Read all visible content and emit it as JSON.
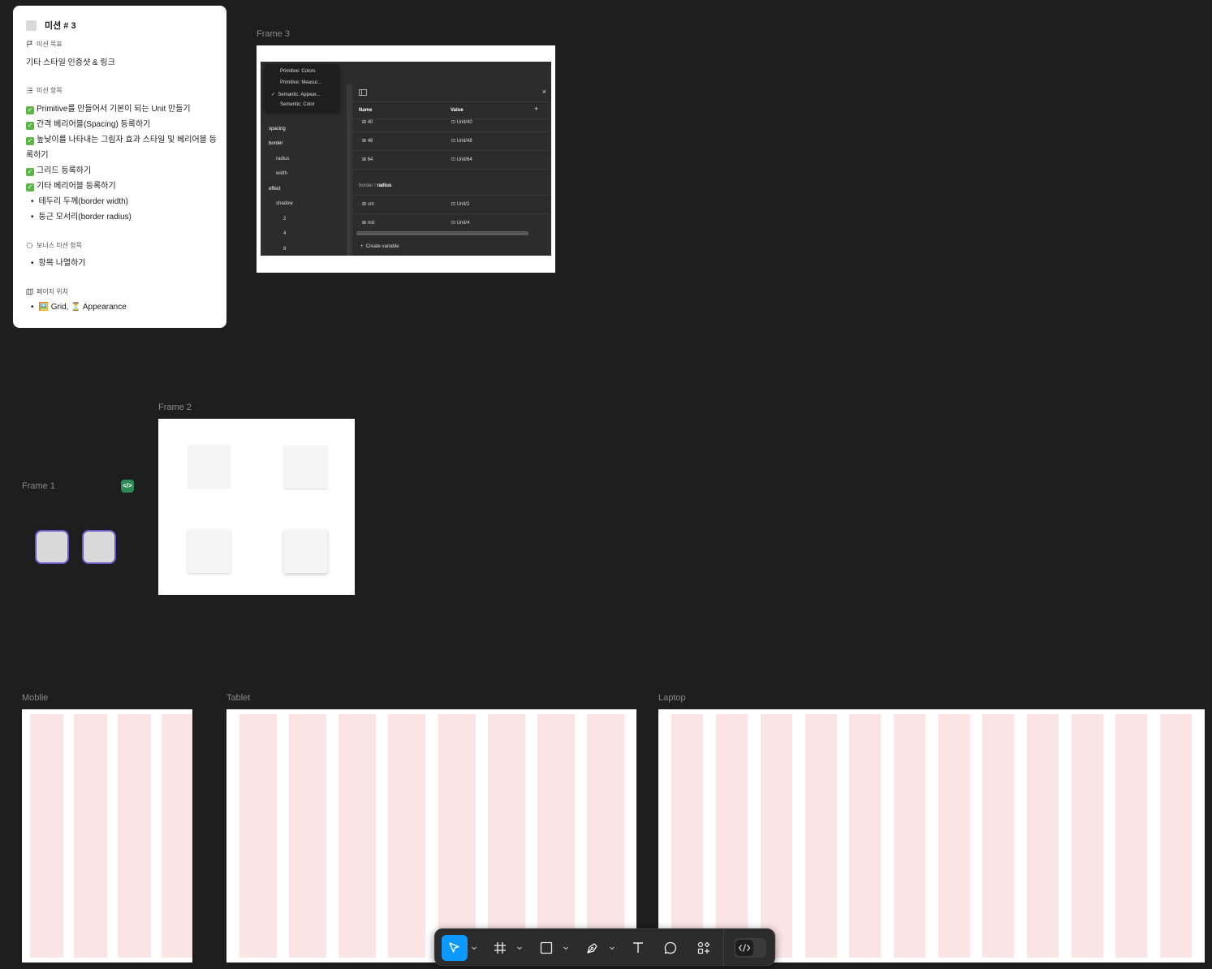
{
  "mission_card": {
    "title": "미션 # 3",
    "goal_heading": "미션 목표",
    "goal_text": "기타 스타일 인증샷 & 링크",
    "items_heading": "미션 항목",
    "items": [
      "Primitive를 만들어서 기본이 되는 Unit 만들기",
      "간격 베리어블(Spacing) 등록하기",
      "높낮이를 나타내는 그림자 효과 스타일 및 베리어블 등",
      "록하기",
      "그리드 등록하기",
      "기타 베리어블 등록하기"
    ],
    "sub_items": [
      "테두리 두께(border width)",
      "둥근 모서리(border radius)"
    ],
    "bonus_heading": "보너스 미션 항목",
    "bonus_items": [
      "항목 나열하기"
    ],
    "page_heading": "페이지 위치",
    "page_items": [
      "🖼️ Grid, ⏳ Appearance"
    ]
  },
  "frames": {
    "frame3": "Frame 3",
    "frame2": "Frame 2",
    "frame1": "Frame 1",
    "mobile": "Moblie",
    "tablet": "Tablet",
    "laptop": "Laptop"
  },
  "frame3_shot": {
    "menu": [
      "Primitive: Colors",
      "Primitive: Measur...",
      "Semantic: Appear...",
      "Sementic: Color"
    ],
    "sidebar": [
      "spacing",
      "border",
      "radius",
      "width",
      "effect",
      "shadow",
      "2",
      "4",
      "8"
    ],
    "col_name": "Name",
    "col_value": "Value",
    "rows": [
      {
        "name": "40",
        "value": "Unit/40"
      },
      {
        "name": "48",
        "value": "Unit/48"
      },
      {
        "name": "64",
        "value": "Unit/64"
      }
    ],
    "group_prefix": "border / ",
    "group_name": "radius",
    "rows2": [
      {
        "name": "sm",
        "value": "Unit/2"
      },
      {
        "name": "md",
        "value": "Unit/4"
      }
    ],
    "create": "Create variable"
  },
  "colors": {
    "canvas": "#1e1e1e",
    "accent": "#0d99ff",
    "grid_column": "#fae5e4",
    "frame1_border": "#6b58c9"
  },
  "toolbar": {
    "tools": [
      "move-tool",
      "frame-tool",
      "shape-tool",
      "pen-tool",
      "text-tool",
      "comment-tool",
      "actions-tool",
      "dev-mode-toggle"
    ]
  }
}
